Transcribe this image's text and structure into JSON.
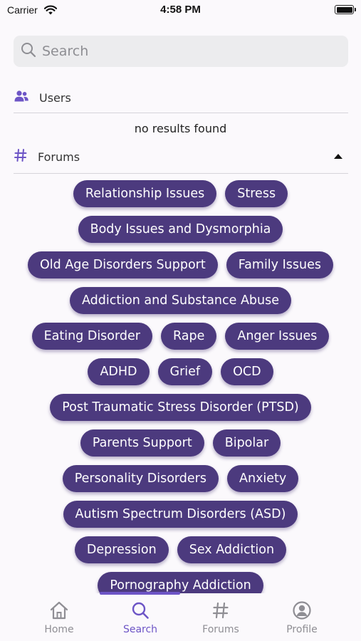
{
  "status_bar": {
    "carrier": "Carrier",
    "time": "4:58 PM"
  },
  "search": {
    "placeholder": "Search",
    "value": ""
  },
  "users_section": {
    "label": "Users",
    "empty_message": "no results found"
  },
  "forums_section": {
    "label": "Forums",
    "tags": [
      "Relationship Issues",
      "Stress",
      "Body Issues and Dysmorphia",
      "Old Age Disorders Support",
      "Family Issues",
      "Addiction and Substance Abuse",
      "Eating Disorder",
      "Rape",
      "Anger Issues",
      "ADHD",
      "Grief",
      "OCD",
      "Post Traumatic Stress Disorder (PTSD)",
      "Parents Support",
      "Bipolar",
      "Personality Disorders",
      "Anxiety",
      "Autism Spectrum Disorders (ASD)",
      "Depression",
      "Sex Addiction",
      "Pornography Addiction"
    ]
  },
  "tab_bar": {
    "home": "Home",
    "search": "Search",
    "forums": "Forums",
    "profile": "Profile",
    "active": "search"
  },
  "colors": {
    "accent": "#6d55c6",
    "tag_background": "#4c3a7e",
    "inactive_tab": "#8f8e94"
  }
}
